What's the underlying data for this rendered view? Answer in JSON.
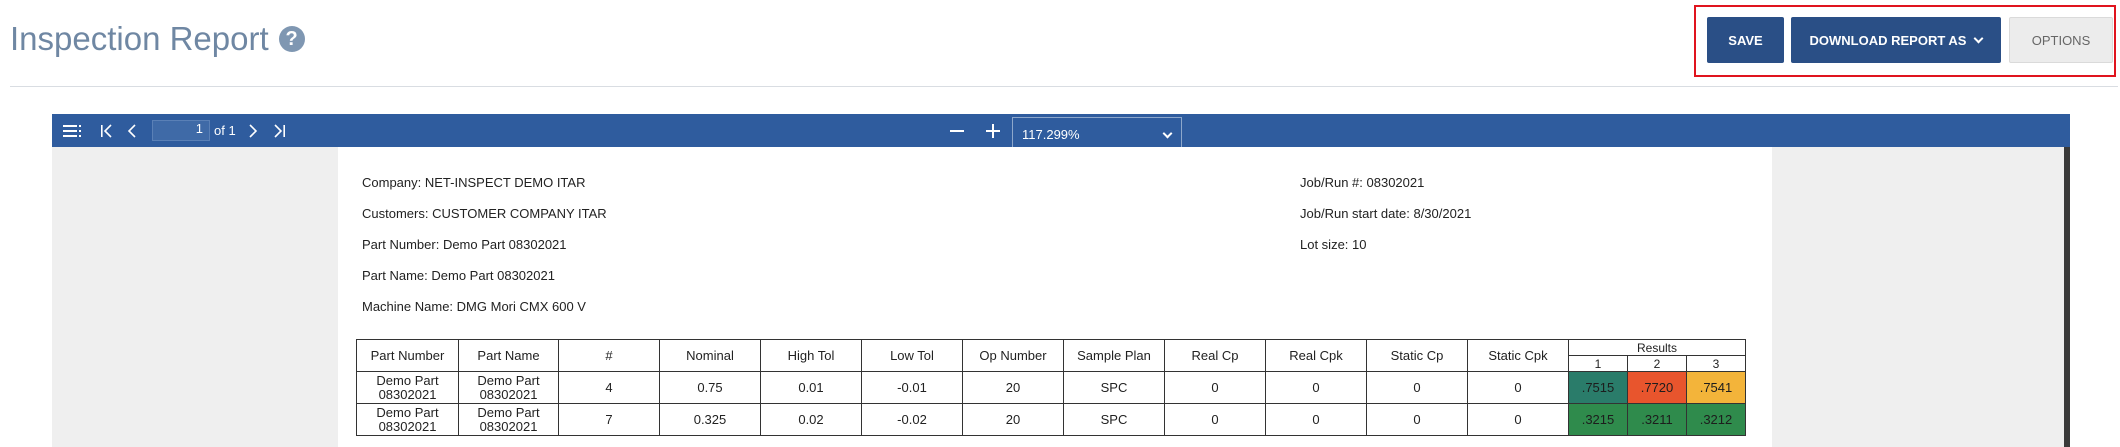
{
  "header": {
    "title": "Inspection Report",
    "help_icon": "?",
    "save_label": "SAVE",
    "download_label": "DOWNLOAD REPORT AS",
    "options_label": "OPTIONS"
  },
  "viewer": {
    "page_value": "1",
    "page_of": "of 1",
    "zoom": "117.299%",
    "toolbar_color": "#2f5c9e"
  },
  "report": {
    "company_label": "Company:",
    "company": "NET-INSPECT DEMO ITAR",
    "customers_label": "Customers:",
    "customers": "CUSTOMER COMPANY ITAR",
    "part_number_label": "Part Number:",
    "part_number": "Demo Part 08302021",
    "part_name_label": "Part Name:",
    "part_name": "Demo Part 08302021",
    "machine_label": "Machine Name:",
    "machine": "DMG Mori CMX 600 V",
    "job_label": "Job/Run #:",
    "job": "08302021",
    "job_start_label": "Job/Run start date:",
    "job_start": "8/30/2021",
    "lot_label": "Lot size:",
    "lot": "10"
  },
  "table": {
    "headers": [
      "Part Number",
      "Part Name",
      "#",
      "Nominal",
      "High Tol",
      "Low Tol",
      "Op Number",
      "Sample Plan",
      "Real Cp",
      "Real Cpk",
      "Static Cp",
      "Static Cpk"
    ],
    "results_header": "Results",
    "result_cols": [
      "1",
      "2",
      "3"
    ],
    "rows": [
      {
        "part_number": "Demo Part 08302021",
        "part_name": "Demo Part 08302021",
        "num": "4",
        "nominal": "0.75",
        "high_tol": "0.01",
        "low_tol": "-0.01",
        "op_number": "20",
        "sample_plan": "SPC",
        "real_cp": "0",
        "real_cpk": "0",
        "static_cp": "0",
        "static_cpk": "0",
        "r1": ".7515",
        "r2": ".7720",
        "r3": ".7541"
      },
      {
        "part_number": "Demo Part 08302021",
        "part_name": "Demo Part 08302021",
        "num": "7",
        "nominal": "0.325",
        "high_tol": "0.02",
        "low_tol": "-0.02",
        "op_number": "20",
        "sample_plan": "SPC",
        "real_cp": "0",
        "real_cpk": "0",
        "static_cp": "0",
        "static_cpk": "0",
        "r1": ".3215",
        "r2": ".3211",
        "r3": ".3212"
      }
    ],
    "status_colors": {
      "in_tol": "#2f8b4c",
      "out_tol": "#e8552d",
      "warning": "#f3b43a",
      "near": "#2a7c6a"
    }
  }
}
